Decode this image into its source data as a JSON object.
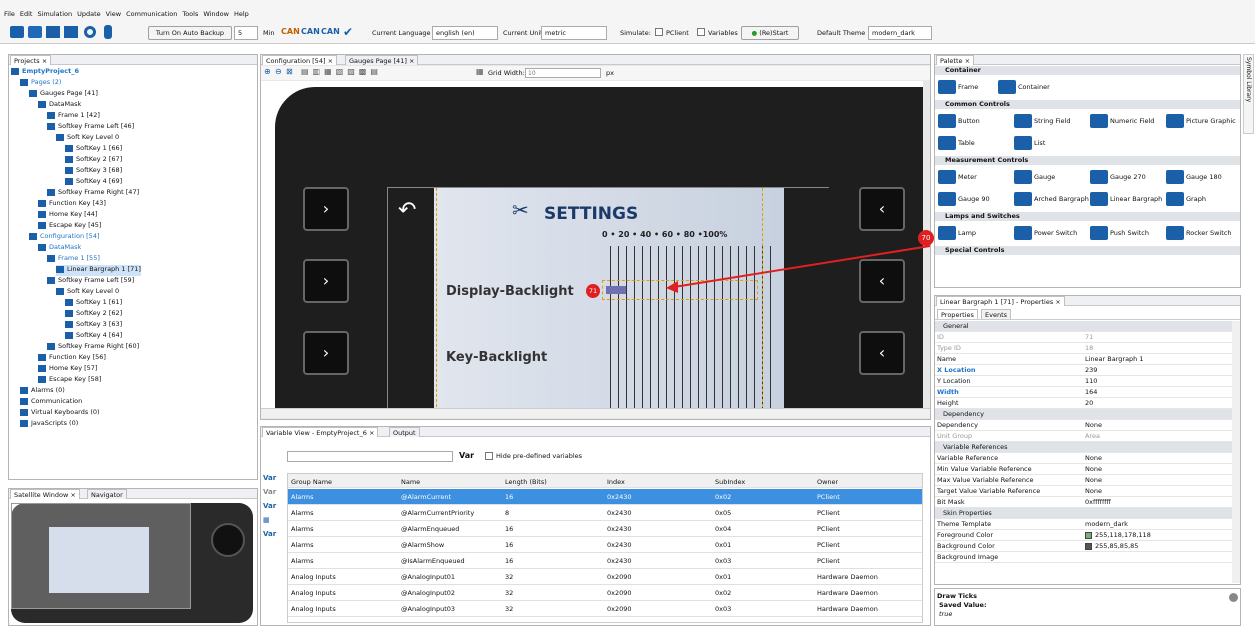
{
  "menu": [
    "File",
    "Edit",
    "Simulation",
    "Update",
    "View",
    "Communication",
    "Tools",
    "Window",
    "Help"
  ],
  "toolbar": {
    "backup_btn": "Turn On Auto Backup",
    "backup_value": "5",
    "backup_unit": "Min",
    "can1": "CAN",
    "can2": "CAN",
    "can3": "CAN",
    "lang_label": "Current Language",
    "lang_value": "english (en)",
    "unit_label": "Current Unit",
    "unit_value": "metric",
    "simulate_label": "Simulate:",
    "pclient": "PClient",
    "variables": "Variables",
    "restart": "(Re)Start",
    "theme_label": "Default Theme",
    "theme_value": "modern_dark"
  },
  "projects": {
    "title": "Projects",
    "tree": [
      {
        "t": "EmptyProject_6",
        "d": 0,
        "c": "#1e73c8",
        "b": true
      },
      {
        "t": "Pages (2)",
        "d": 1,
        "c": "#1e73c8"
      },
      {
        "t": "Gauges Page [41]",
        "d": 2
      },
      {
        "t": "DataMask",
        "d": 3
      },
      {
        "t": "Frame 1 [42]",
        "d": 4
      },
      {
        "t": "Softkey Frame Left [46]",
        "d": 4
      },
      {
        "t": "Soft Key Level 0",
        "d": 5
      },
      {
        "t": "SoftKey 1 [66]",
        "d": 6
      },
      {
        "t": "SoftKey 2 [67]",
        "d": 6
      },
      {
        "t": "SoftKey 3 [68]",
        "d": 6
      },
      {
        "t": "SoftKey 4 [69]",
        "d": 6
      },
      {
        "t": "Softkey Frame Right [47]",
        "d": 4
      },
      {
        "t": "Function Key [43]",
        "d": 3
      },
      {
        "t": "Home Key [44]",
        "d": 3
      },
      {
        "t": "Escape Key [45]",
        "d": 3
      },
      {
        "t": "Configuration [54]",
        "d": 2,
        "c": "#1e73c8"
      },
      {
        "t": "DataMask",
        "d": 3,
        "c": "#1e73c8"
      },
      {
        "t": "Frame 1 [55]",
        "d": 4,
        "c": "#1e73c8"
      },
      {
        "t": "Linear Bargraph 1 [71]",
        "d": 5,
        "sel": true
      },
      {
        "t": "Softkey Frame Left [59]",
        "d": 4
      },
      {
        "t": "Soft Key Level 0",
        "d": 5
      },
      {
        "t": "SoftKey 1 [61]",
        "d": 6
      },
      {
        "t": "SoftKey 2 [62]",
        "d": 6
      },
      {
        "t": "SoftKey 3 [63]",
        "d": 6
      },
      {
        "t": "SoftKey 4 [64]",
        "d": 6
      },
      {
        "t": "Softkey Frame Right [60]",
        "d": 4
      },
      {
        "t": "Function Key [56]",
        "d": 3
      },
      {
        "t": "Home Key [57]",
        "d": 3
      },
      {
        "t": "Escape Key [58]",
        "d": 3
      },
      {
        "t": "Alarms (0)",
        "d": 1
      },
      {
        "t": "Communication",
        "d": 1
      },
      {
        "t": "Virtual Keyboards (0)",
        "d": 1
      },
      {
        "t": "JavaScripts (0)",
        "d": 1
      }
    ]
  },
  "satellite": {
    "tab1": "Satellite Window",
    "tab2": "Navigator"
  },
  "editor": {
    "tab1": "Configuration [54]",
    "tab2": "Gauges Page [41]",
    "grid_label": "Grid Width:",
    "grid_value": "10",
    "grid_unit": "px"
  },
  "device": {
    "title": "SETTINGS",
    "scale": "0  •  20  •  40  •  60  •  80  •100%",
    "row1": "Display-Backlight",
    "row2": "Key-Backlight",
    "badge70": "70",
    "badge71": "71"
  },
  "variables": {
    "tab1": "Variable View - EmptyProject_6",
    "tab2": "Output",
    "hide_label": "Hide pre-defined variables",
    "var_icon": "Var",
    "headers": [
      "Group Name",
      "Name",
      "Length (Bits)",
      "Index",
      "SubIndex",
      "Owner"
    ],
    "rows": [
      [
        "Alarms",
        "@AlarmCurrent",
        "16",
        "0x2430",
        "0x02",
        "PClient"
      ],
      [
        "Alarms",
        "@AlarmCurrentPriority",
        "8",
        "0x2430",
        "0x05",
        "PClient"
      ],
      [
        "Alarms",
        "@AlarmEnqueued",
        "16",
        "0x2430",
        "0x04",
        "PClient"
      ],
      [
        "Alarms",
        "@AlarmShow",
        "16",
        "0x2430",
        "0x01",
        "PClient"
      ],
      [
        "Alarms",
        "@IsAlarmEnqueued",
        "16",
        "0x2430",
        "0x03",
        "PClient"
      ],
      [
        "Analog Inputs",
        "@AnalogInput01",
        "32",
        "0x2090",
        "0x01",
        "Hardware Daemon"
      ],
      [
        "Analog Inputs",
        "@AnalogInput02",
        "32",
        "0x2090",
        "0x02",
        "Hardware Daemon"
      ],
      [
        "Analog Inputs",
        "@AnalogInput03",
        "32",
        "0x2090",
        "0x03",
        "Hardware Daemon"
      ]
    ]
  },
  "palette": {
    "title": "Palette",
    "side_label": "Symbol Library",
    "sections": [
      {
        "name": "Container",
        "items": [
          "Frame",
          "Container"
        ]
      },
      {
        "name": "Common Controls",
        "items": [
          "Button",
          "String Field",
          "Numeric Field",
          "Picture Graphic",
          "Table",
          "List"
        ]
      },
      {
        "name": "Measurement Controls",
        "items": [
          "Meter",
          "Gauge",
          "Gauge 270",
          "Gauge 180",
          "Gauge 90",
          "Arched Bargraph",
          "Linear Bargraph",
          "Graph"
        ]
      },
      {
        "name": "Lamps and Switches",
        "items": [
          "Lamp",
          "Power Switch",
          "Push Switch",
          "Rocker Switch"
        ]
      },
      {
        "name": "Special Controls",
        "items": []
      }
    ]
  },
  "properties": {
    "title": "Linear Bargraph 1 [71] - Properties",
    "tab1": "Properties",
    "tab2": "Events",
    "rows": [
      {
        "s": "General"
      },
      {
        "k": "ID",
        "v": "71",
        "g": true
      },
      {
        "k": "Type ID",
        "v": "18",
        "g": true
      },
      {
        "k": "Name",
        "v": "Linear Bargraph 1"
      },
      {
        "k": "X Location",
        "v": "239",
        "b": true
      },
      {
        "k": "Y Location",
        "v": "110"
      },
      {
        "k": "Width",
        "v": "164",
        "b": true
      },
      {
        "k": "Height",
        "v": "20"
      },
      {
        "s": "Dependency"
      },
      {
        "k": "Dependency",
        "v": "None"
      },
      {
        "k": "Unit Group",
        "v": "Area",
        "g": true
      },
      {
        "s": "Variable References"
      },
      {
        "k": "Variable Reference",
        "v": "None"
      },
      {
        "k": "Min Value Variable Reference",
        "v": "None"
      },
      {
        "k": "Max Value Variable Reference",
        "v": "None"
      },
      {
        "k": "Target Value Variable Reference",
        "v": "None"
      },
      {
        "k": "Bit Mask",
        "v": "0xffffffff"
      },
      {
        "s": "Skin Properties"
      },
      {
        "k": "Theme Template",
        "v": "modern_dark"
      },
      {
        "k": "Foreground Color",
        "v": "255,118,178,118",
        "sw": "#76b276"
      },
      {
        "k": "Background Color",
        "v": "255,85,85,85",
        "sw": "#555555"
      },
      {
        "k": "Background Image",
        "v": ""
      }
    ],
    "desc_title": "Draw Ticks",
    "desc_label": "Saved Value:",
    "desc_value": "true"
  },
  "colors": {
    "accent": "#1e73c8",
    "selection": "#3d8fe0",
    "marker": "#e02020"
  }
}
